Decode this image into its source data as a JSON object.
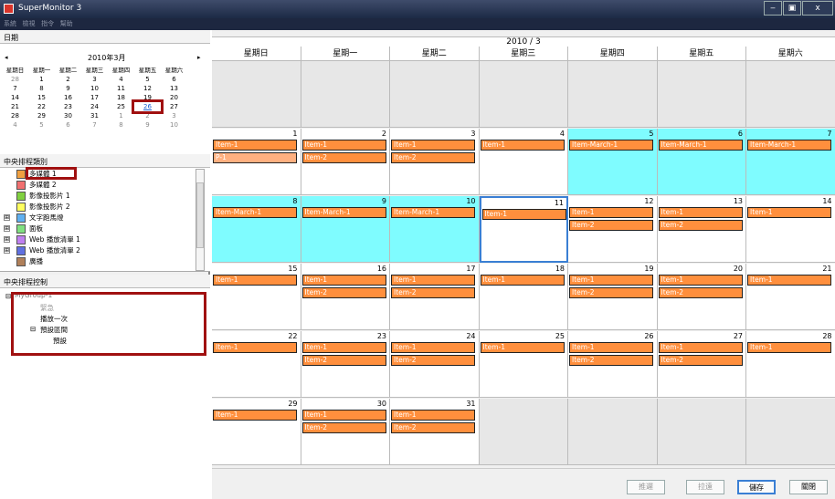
{
  "window": {
    "title": "SuperMonitor 3",
    "min": "‒",
    "max": "▣",
    "close": "x"
  },
  "menu": [
    "系統",
    "檢視",
    "指令",
    "幫助"
  ],
  "left": {
    "date_header": "日期",
    "minical": {
      "prev": "◂",
      "next": "▸",
      "title": "2010年3月",
      "weekdays": [
        "星期日",
        "星期一",
        "星期二",
        "星期三",
        "星期四",
        "星期五",
        "星期六"
      ],
      "weeks": [
        [
          "28",
          "1",
          "2",
          "3",
          "4",
          "5",
          "6"
        ],
        [
          "7",
          "8",
          "9",
          "10",
          "11",
          "12",
          "13"
        ],
        [
          "14",
          "15",
          "16",
          "17",
          "18",
          "19",
          "20"
        ],
        [
          "21",
          "22",
          "23",
          "24",
          "25",
          "26",
          "27"
        ],
        [
          "28",
          "29",
          "30",
          "31",
          "1",
          "2",
          "3"
        ],
        [
          "4",
          "5",
          "6",
          "7",
          "8",
          "9",
          "10"
        ]
      ],
      "selected": "26"
    },
    "category_header": "中央排程類別",
    "categories": [
      {
        "label": "多媒體 1",
        "color": "#f0a040"
      },
      {
        "label": "多媒體 2",
        "color": "#f07070"
      },
      {
        "label": "影像投影片 1",
        "color": "#80d040"
      },
      {
        "label": "影像投影片 2",
        "color": "#ffff60"
      },
      {
        "label": "文字跑馬燈",
        "color": "#60b0f0",
        "exp": "⊞"
      },
      {
        "label": "面板",
        "color": "#80e080",
        "exp": "⊞"
      },
      {
        "label": "Web 播放清單 1",
        "color": "#c080f0",
        "exp": "⊞"
      },
      {
        "label": "Web 播放清單 2",
        "color": "#6070e0",
        "exp": "⊞"
      },
      {
        "label": "廣播",
        "color": "#b0805a"
      }
    ],
    "control_header": "中央排程控制",
    "tree": {
      "root": "MyGroup-1",
      "root_exp": "⊟",
      "n1": "緊急",
      "n2": "播放一次",
      "n3": "預設區間",
      "n3_exp": "⊟",
      "n4": "預設"
    }
  },
  "calendar": {
    "title": "2010 / 3",
    "weekdays": [
      "星期日",
      "星期一",
      "星期二",
      "星期三",
      "星期四",
      "星期五",
      "星期六"
    ],
    "days": [
      {
        "n": "",
        "t": "empty"
      },
      {
        "n": "",
        "t": "empty"
      },
      {
        "n": "",
        "t": "empty"
      },
      {
        "n": "",
        "t": "empty"
      },
      {
        "n": "",
        "t": "empty"
      },
      {
        "n": "",
        "t": "empty"
      },
      {
        "n": "",
        "t": "empty"
      },
      {
        "n": "1",
        "ev": [
          "Item-1",
          "P-1"
        ],
        "light": [
          1
        ]
      },
      {
        "n": "2",
        "ev": [
          "Item-1",
          "Item-2"
        ]
      },
      {
        "n": "3",
        "ev": [
          "Item-1",
          "Item-2"
        ]
      },
      {
        "n": "4",
        "ev": [
          "Item-1"
        ]
      },
      {
        "n": "5",
        "t": "cyan",
        "ev": [
          "Item-March-1"
        ]
      },
      {
        "n": "6",
        "t": "cyan",
        "ev": [
          "Item-March-1"
        ]
      },
      {
        "n": "7",
        "t": "cyan",
        "ev": [
          "Item-March-1"
        ]
      },
      {
        "n": "8",
        "t": "cyan",
        "ev": [
          "Item-March-1"
        ]
      },
      {
        "n": "9",
        "t": "cyan",
        "ev": [
          "Item-March-1"
        ]
      },
      {
        "n": "10",
        "t": "cyan",
        "ev": [
          "Item-March-1"
        ]
      },
      {
        "n": "11",
        "t": "today",
        "ev": [
          "Item-1"
        ]
      },
      {
        "n": "12",
        "ev": [
          "Item-1",
          "Item-2"
        ]
      },
      {
        "n": "13",
        "ev": [
          "Item-1",
          "Item-2"
        ]
      },
      {
        "n": "14",
        "ev": [
          "Item-1"
        ]
      },
      {
        "n": "15",
        "ev": [
          "Item-1"
        ]
      },
      {
        "n": "16",
        "ev": [
          "Item-1",
          "Item-2"
        ]
      },
      {
        "n": "17",
        "ev": [
          "Item-1",
          "Item-2"
        ]
      },
      {
        "n": "18",
        "ev": [
          "Item-1"
        ]
      },
      {
        "n": "19",
        "ev": [
          "Item-1",
          "Item-2"
        ]
      },
      {
        "n": "20",
        "ev": [
          "Item-1",
          "Item-2"
        ]
      },
      {
        "n": "21",
        "ev": [
          "Item-1"
        ]
      },
      {
        "n": "22",
        "ev": [
          "Item-1"
        ]
      },
      {
        "n": "23",
        "ev": [
          "Item-1",
          "Item-2"
        ]
      },
      {
        "n": "24",
        "ev": [
          "Item-1",
          "Item-2"
        ]
      },
      {
        "n": "25",
        "ev": [
          "Item-1"
        ]
      },
      {
        "n": "26",
        "ev": [
          "Item-1",
          "Item-2"
        ]
      },
      {
        "n": "27",
        "ev": [
          "Item-1",
          "Item-2"
        ]
      },
      {
        "n": "28",
        "ev": [
          "Item-1"
        ]
      },
      {
        "n": "29",
        "ev": [
          "Item-1"
        ]
      },
      {
        "n": "30",
        "ev": [
          "Item-1",
          "Item-2"
        ]
      },
      {
        "n": "31",
        "ev": [
          "Item-1",
          "Item-2"
        ]
      },
      {
        "n": "",
        "t": "empty"
      },
      {
        "n": "",
        "t": "empty"
      },
      {
        "n": "",
        "t": "empty"
      },
      {
        "n": "",
        "t": "empty"
      }
    ]
  },
  "buttons": {
    "push": "推遲",
    "pull": "拉遠",
    "save": "儲存",
    "close": "關閉"
  }
}
